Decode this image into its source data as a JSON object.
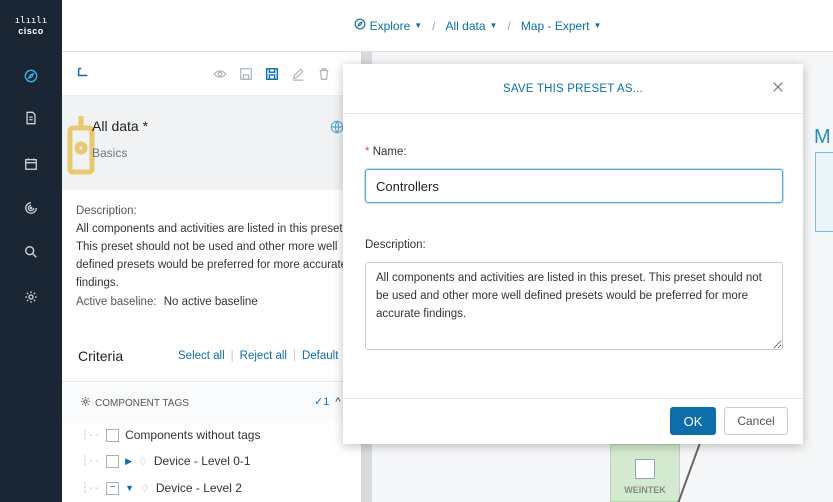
{
  "logo": {
    "text": "cisco"
  },
  "rail": {
    "items": [
      {
        "icon": "compass-icon",
        "active": true
      },
      {
        "icon": "document-icon",
        "active": false
      },
      {
        "icon": "calendar-icon",
        "active": false
      },
      {
        "icon": "radar-icon",
        "active": false
      },
      {
        "icon": "search-icon",
        "active": false
      },
      {
        "icon": "gear-icon",
        "active": false
      }
    ]
  },
  "breadcrumb": {
    "explore": "Explore",
    "sep1": "/",
    "all_data": "All data",
    "sep2": "/",
    "map_expert": "Map - Expert"
  },
  "panel": {
    "preset_title": "All data *",
    "preset_subtitle": "Basics",
    "description_label": "Description:",
    "description_text": "All components and activities are listed in this preset. This preset should not be used and other more well defined presets would be preferred for more accurate findings.",
    "baseline_label": "Active baseline:",
    "baseline_value": "No active baseline",
    "criteria_title": "Criteria",
    "select_all": "Select all",
    "reject_all": "Reject all",
    "default": "Default",
    "tags_title": "COMPONENT TAGS",
    "tags_count": "✓1",
    "tree": [
      {
        "label": "Components without tags",
        "state": "unchecked",
        "expandable": false
      },
      {
        "label": "Device - Level 0-1",
        "state": "unchecked",
        "expandable": true,
        "expanded": false
      },
      {
        "label": "Device - Level 2",
        "state": "partial",
        "expandable": true,
        "expanded": true
      }
    ]
  },
  "map": {
    "title_fragment": "M",
    "node_label": "WEINTEK"
  },
  "modal": {
    "title": "SAVE THIS PRESET AS...",
    "name_required": "*",
    "name_label": "Name:",
    "name_value": "Controllers",
    "description_label": "Description:",
    "description_value": "All components and activities are listed in this preset. This preset should not be used and other more well defined presets would be preferred for more accurate findings.",
    "ok": "OK",
    "cancel": "Cancel"
  },
  "colors": {
    "accent": "#0d6eaa",
    "rail": "#1b2634",
    "required": "#d9534f"
  }
}
